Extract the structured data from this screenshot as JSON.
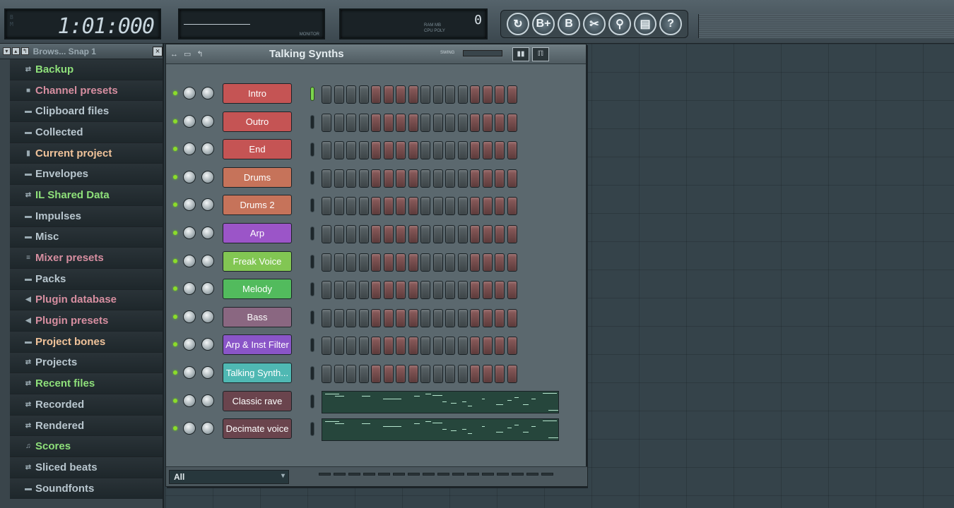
{
  "topbar": {
    "time": "1:01:000",
    "time_units": [
      "B",
      "M"
    ],
    "monitor_label": "MONITOR",
    "cpu_labels": [
      "RAM",
      "MB",
      "CPU",
      "POLY"
    ],
    "cpu_value": "0",
    "tools": [
      {
        "name": "undo-icon",
        "glyph": "↻"
      },
      {
        "name": "save-template-icon",
        "glyph": "B+"
      },
      {
        "name": "save-icon",
        "glyph": "B"
      },
      {
        "name": "cut-icon",
        "glyph": "✂"
      },
      {
        "name": "mic-icon",
        "glyph": "⚲"
      },
      {
        "name": "page-icon",
        "glyph": "▤"
      },
      {
        "name": "help-icon",
        "glyph": "?"
      }
    ]
  },
  "browser": {
    "title": "Brows... Snap 1",
    "items": [
      {
        "label": "Backup",
        "color": "#8ee07a",
        "icon": "⇄"
      },
      {
        "label": "Channel presets",
        "color": "#d68ea0",
        "icon": "■"
      },
      {
        "label": "Clipboard files",
        "color": "#b8c6ce",
        "icon": "▬"
      },
      {
        "label": "Collected",
        "color": "#b8c6ce",
        "icon": "▬"
      },
      {
        "label": "Current project",
        "color": "#f0c39a",
        "icon": "▮"
      },
      {
        "label": "Envelopes",
        "color": "#b8c6ce",
        "icon": "▬"
      },
      {
        "label": "IL Shared Data",
        "color": "#8ee07a",
        "icon": "⇄"
      },
      {
        "label": "Impulses",
        "color": "#b8c6ce",
        "icon": "▬"
      },
      {
        "label": "Misc",
        "color": "#b8c6ce",
        "icon": "▬"
      },
      {
        "label": "Mixer presets",
        "color": "#d68ea0",
        "icon": "≡"
      },
      {
        "label": "Packs",
        "color": "#b8c6ce",
        "icon": "▬"
      },
      {
        "label": "Plugin database",
        "color": "#d68ea0",
        "icon": "◀"
      },
      {
        "label": "Plugin presets",
        "color": "#d68ea0",
        "icon": "◀"
      },
      {
        "label": "Project bones",
        "color": "#f0c39a",
        "icon": "▬"
      },
      {
        "label": "Projects",
        "color": "#b8c6ce",
        "icon": "⇄"
      },
      {
        "label": "Recent files",
        "color": "#8ee07a",
        "icon": "⇄"
      },
      {
        "label": "Recorded",
        "color": "#b8c6ce",
        "icon": "⇄"
      },
      {
        "label": "Rendered",
        "color": "#b8c6ce",
        "icon": "⇄"
      },
      {
        "label": "Scores",
        "color": "#8ee07a",
        "icon": "♫"
      },
      {
        "label": "Sliced beats",
        "color": "#b8c6ce",
        "icon": "⇄"
      },
      {
        "label": "Soundfonts",
        "color": "#b8c6ce",
        "icon": "▬"
      }
    ]
  },
  "channel_rack": {
    "title": "Talking Synths",
    "swing_label": "SWING",
    "filter": "All",
    "channels": [
      {
        "label": "Intro",
        "color": "#c55454",
        "type": "steps",
        "selected": true
      },
      {
        "label": "Outro",
        "color": "#c55454",
        "type": "steps",
        "selected": false
      },
      {
        "label": "End",
        "color": "#c55454",
        "type": "steps",
        "selected": false
      },
      {
        "label": "Drums",
        "color": "#c6735a",
        "type": "steps",
        "selected": false
      },
      {
        "label": "Drums 2",
        "color": "#c6735a",
        "type": "steps",
        "selected": false
      },
      {
        "label": "Arp",
        "color": "#9b55c8",
        "type": "steps",
        "selected": false
      },
      {
        "label": "Freak Voice",
        "color": "#82c653",
        "type": "steps",
        "selected": false
      },
      {
        "label": "Melody",
        "color": "#52bb5d",
        "type": "steps",
        "selected": false
      },
      {
        "label": "Bass",
        "color": "#8a6781",
        "type": "steps",
        "selected": false
      },
      {
        "label": "Arp & Inst Filter",
        "color": "#8a55c8",
        "type": "steps",
        "selected": false
      },
      {
        "label": "Talking Synth...",
        "color": "#4fb8b3",
        "type": "steps",
        "selected": false
      },
      {
        "label": "Classic rave",
        "color": "#6a444d",
        "type": "pianoroll",
        "selected": false
      },
      {
        "label": "Decimate voice",
        "color": "#6a444d",
        "type": "pianoroll",
        "selected": false
      }
    ]
  }
}
